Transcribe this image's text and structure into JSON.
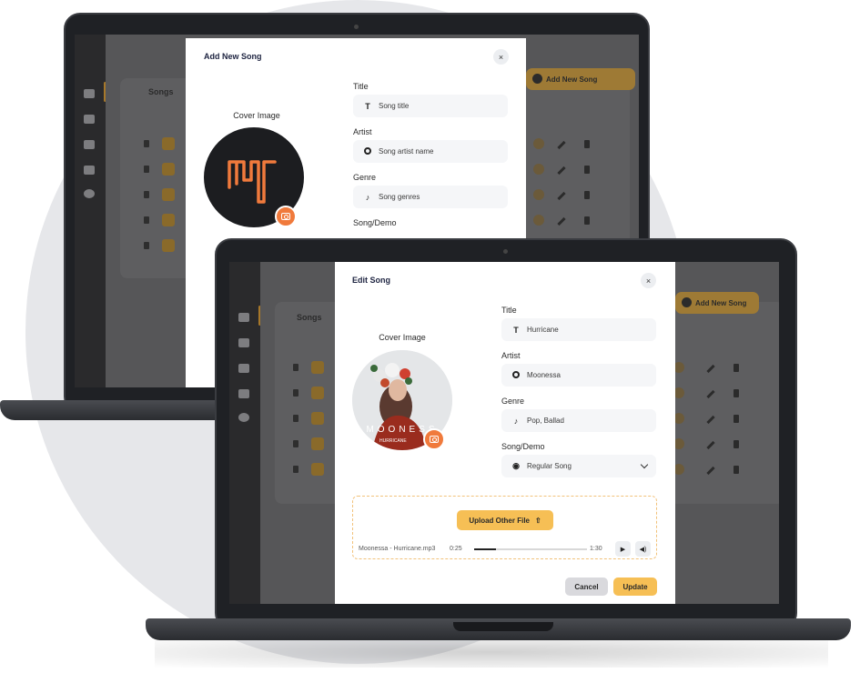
{
  "add_modal": {
    "title": "Add New Song",
    "close_label": "×",
    "cover_label": "Cover Image",
    "fields": [
      {
        "label": "Title",
        "placeholder": "Song title",
        "icon": "text-icon"
      },
      {
        "label": "Artist",
        "placeholder": "Song artist name",
        "icon": "disc-icon"
      },
      {
        "label": "Genre",
        "placeholder": "Song genres",
        "icon": "music-note-icon"
      },
      {
        "label": "Song/Demo"
      }
    ]
  },
  "edit_modal": {
    "title": "Edit Song",
    "close_label": "×",
    "cover_label": "Cover Image",
    "cover_text": "MOONESS",
    "cover_subtext": "HURRICANE",
    "fields": [
      {
        "label": "Title",
        "value": "Hurricane",
        "icon": "text-icon"
      },
      {
        "label": "Artist",
        "value": "Moonessa",
        "icon": "disc-icon"
      },
      {
        "label": "Genre",
        "value": "Pop, Ballad",
        "icon": "music-note-icon"
      },
      {
        "label": "Song/Demo",
        "value": "Regular Song",
        "icon": "user-circle-icon"
      }
    ],
    "upload_label": "Upload Other File",
    "audio": {
      "file_name": "Moonessa - Hurricane.mp3",
      "current_time": "0:25",
      "duration": "1:30",
      "progress": 0.19
    },
    "cancel_label": "Cancel",
    "update_label": "Update"
  },
  "background_app": {
    "section_title": "Songs",
    "add_button_label": "Add New Song"
  },
  "colors": {
    "accent": "#f6bf55",
    "camera_button": "#f07a3c",
    "title_text": "#1d2340"
  }
}
